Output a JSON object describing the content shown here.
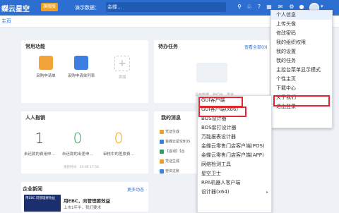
{
  "topbar": {
    "brand": "蝶云星空",
    "badge_orange": "旗舰版",
    "badge_blue": "",
    "account_label": "演示数据：",
    "account_value": "金蝶…",
    "account_suffix": "理'动"
  },
  "tabbar": {
    "home": "主页"
  },
  "common_functions": {
    "title": "常用功能",
    "items": [
      {
        "label": "采购申请单",
        "color": "#f2a43a"
      },
      {
        "label": "采购申请单列表",
        "color": "#3d7fe0"
      },
      {
        "label": "添加",
        "color": "#dfe3ea"
      }
    ]
  },
  "pending_tasks": {
    "title": "待办任务",
    "link": "查看全部(0)",
    "empty_text": "没有数据，我们会…再来"
  },
  "person_index": {
    "title": "人人指销",
    "stats": [
      {
        "value": "1",
        "label": "未还款的费用申…",
        "color": "#333333"
      },
      {
        "value": "0",
        "label": "未还款的出差申…",
        "color": "#2fa05a"
      },
      {
        "value": "0",
        "label": "审核中的差旅费…",
        "color": "#f0a020"
      }
    ],
    "date": "更新时间：10-06 17:56"
  },
  "my_news": {
    "title": "我的消息",
    "items": [
      {
        "text": "凭证生成",
        "color": "#f0a020"
      },
      {
        "text": "金蝶云星空BOS",
        "color": "#3d7fe0"
      },
      {
        "text": "【咨询】【合",
        "color": "#2fa05a"
      },
      {
        "text": "凭证生成",
        "color": "#f0a020"
      },
      {
        "text": "劳资过账",
        "color": "#3d7fe0"
      },
      {
        "text": "凭证生成报…",
        "color": "#f0a020"
      }
    ]
  },
  "enterprise_news": {
    "title": "企业新闻",
    "link": "更多动态",
    "headline": "用EBC，向管理要效益",
    "body": "上市1年半，我们要求",
    "thumb_text": "用EBC 向管理要效益"
  },
  "user_menu": {
    "items": [
      "个人信息",
      "上传头像",
      "修改密码",
      "我的组织权限",
      "我的设置",
      "我的任务",
      "主控台菜单显示模式",
      "个性主页",
      "下载中心",
      "关于我们",
      "退出登录"
    ]
  },
  "download_menu": {
    "items": [
      "GUI客户端",
      "GUI客户端(x86)",
      "BOS设计器",
      "BOS套打设计器",
      "万能报表设计器",
      "金蝶云零售门店客户端(POS)",
      "金蝶云零售门店客户端(APP)",
      "网络检测工具",
      "星空卫士",
      "RPA机器人客户端",
      "设计器(x64)"
    ]
  },
  "colors": {
    "accent": "#2c6fd1",
    "highlight": "#e0282e"
  }
}
